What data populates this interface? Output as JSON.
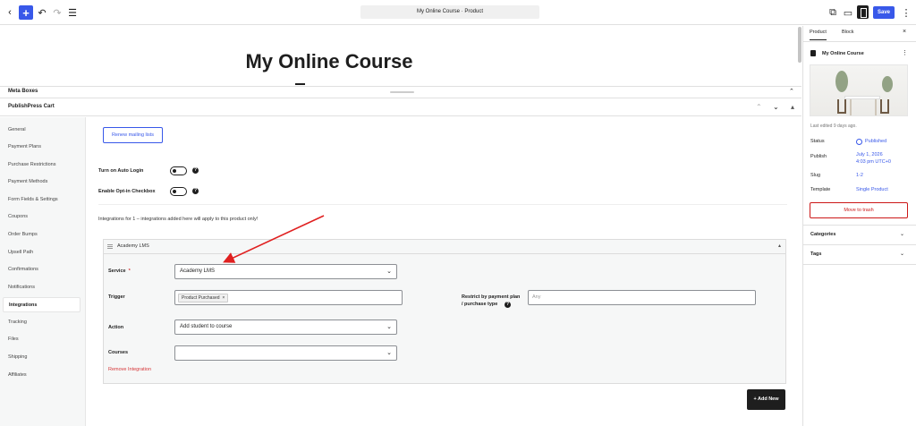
{
  "toolbar": {
    "back_icon": "back-icon",
    "add_icon": "plus-icon",
    "document_title": "My Online Course · Product",
    "save_label": "Save"
  },
  "editor": {
    "post_title": "My Online Course"
  },
  "meta_boxes": {
    "label": "Meta Boxes"
  },
  "publishpress_cart": {
    "label": "PublishPress Cart",
    "nav": [
      {
        "label": "General"
      },
      {
        "label": "Payment Plans"
      },
      {
        "label": "Purchase Restrictions"
      },
      {
        "label": "Payment Methods"
      },
      {
        "label": "Form Fields & Settings"
      },
      {
        "label": "Coupons"
      },
      {
        "label": "Order Bumps"
      },
      {
        "label": "Upsell Path"
      },
      {
        "label": "Confirmations"
      },
      {
        "label": "Notifications"
      },
      {
        "label": "Integrations"
      },
      {
        "label": "Tracking"
      },
      {
        "label": "Files"
      },
      {
        "label": "Shipping"
      },
      {
        "label": "Affiliates"
      }
    ],
    "active_nav": "Integrations",
    "renew_label": "Renew mailing lists",
    "auto_login_label": "Turn on Auto Login",
    "opt_in_label": "Enable Opt-in Checkbox",
    "integration_note": "Integrations for 1 – integrations added here will apply to this product only!",
    "integration": {
      "title": "Academy LMS",
      "service_label": "Service",
      "service_required": "*",
      "service_value": "Academy LMS",
      "trigger_label": "Trigger",
      "trigger_tag": "Product Purchased",
      "trigger_tag_remove": "×",
      "restrict_label_1": "Restrict by payment plan",
      "restrict_label_2": "/ purchase type",
      "restrict_placeholder": "Any",
      "action_label": "Action",
      "action_value": "Add student to course",
      "courses_label": "Courses",
      "courses_value": "",
      "remove_label": "Remove Integration"
    },
    "add_new_label": "+ Add New"
  },
  "sidebar": {
    "tabs": [
      {
        "label": "Product"
      },
      {
        "label": "Block"
      }
    ],
    "close_glyph": "×",
    "post_title": "My Online Course",
    "last_edited": "Last edited 9 days ago.",
    "status_key": "Status",
    "status_value": "Published",
    "publish_key": "Publish",
    "publish_value_1": "July 1, 2026",
    "publish_value_2": "4:03 pm UTC+0",
    "slug_key": "Slug",
    "slug_value": "1-2",
    "template_key": "Template",
    "template_value": "Single Product",
    "trash_label": "Move to trash",
    "panels": [
      {
        "label": "Categories"
      },
      {
        "label": "Tags"
      }
    ]
  },
  "colors": {
    "accent": "#3858e9",
    "danger": "#cc1818",
    "annotation_arrow": "#e02020"
  }
}
